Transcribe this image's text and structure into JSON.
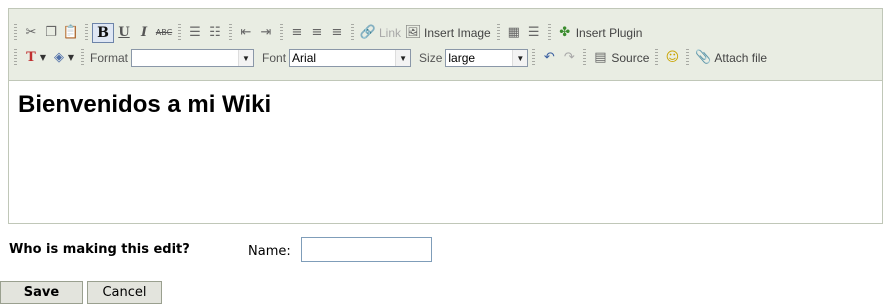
{
  "toolbar": {
    "row1": {
      "cut_icon": "scissors-icon",
      "copy_icon": "copy-icon",
      "paste_icon": "paste-icon",
      "bold_glyph": "B",
      "underline_glyph": "U",
      "italic_glyph": "I",
      "strike_glyph": "ABC",
      "link_label": "Link",
      "insert_image_label": "Insert Image",
      "insert_plugin_label": "Insert Plugin"
    },
    "row2": {
      "format_label": "Format",
      "format_value": "",
      "font_label": "Font",
      "font_value": "Arial",
      "size_label": "Size",
      "size_value": "large",
      "source_label": "Source",
      "attach_label": "Attach file"
    },
    "colors": {
      "background": "#e9ede3",
      "border": "#c0c7b8",
      "active_button": "#dfe7f4"
    }
  },
  "content": {
    "heading": "Bienvenidos a mi Wiki"
  },
  "form": {
    "who_label": "Who is making this edit?",
    "name_label": "Name:",
    "name_value": "",
    "save_label": "Save",
    "cancel_label": "Cancel"
  }
}
